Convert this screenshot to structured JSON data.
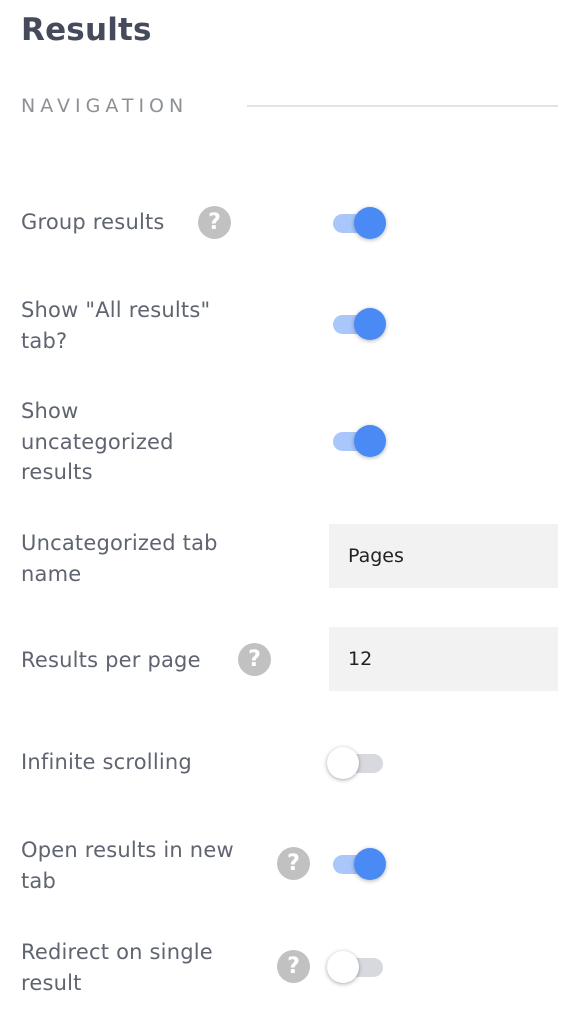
{
  "page": {
    "title": "Results",
    "section_title": "NAVIGATION"
  },
  "settings": {
    "group_results": {
      "label": "Group results",
      "has_help": true,
      "help_symbol": "?",
      "enabled": true
    },
    "show_all_results_tab": {
      "label": "Show \"All results\" tab?",
      "has_help": false,
      "enabled": true
    },
    "show_uncategorized": {
      "label": "Show uncategorized results",
      "has_help": false,
      "enabled": true
    },
    "uncategorized_tab_name": {
      "label": "Uncategorized tab name",
      "value": "Pages"
    },
    "results_per_page": {
      "label": "Results per page",
      "has_help": true,
      "help_symbol": "?",
      "value": "12"
    },
    "infinite_scrolling": {
      "label": "Infinite scrolling",
      "has_help": false,
      "enabled": false
    },
    "open_in_new_tab": {
      "label": "Open results in new tab",
      "has_help": true,
      "help_symbol": "?",
      "enabled": true
    },
    "redirect_single": {
      "label": "Redirect on single result",
      "has_help": true,
      "help_symbol": "?",
      "enabled": false
    }
  },
  "colors": {
    "accent": "#4a8af4",
    "accent_track": "#a9c7fb",
    "off_track": "#d7d9df",
    "help_bg": "#c1c1c1",
    "input_bg": "#f2f2f2"
  },
  "icons": {
    "help": "question-mark-circle-icon"
  }
}
